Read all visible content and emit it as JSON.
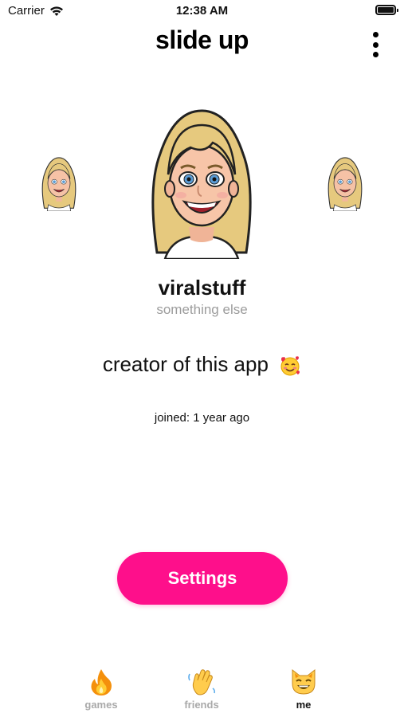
{
  "status_bar": {
    "carrier": "Carrier",
    "time": "12:38 AM"
  },
  "header": {
    "title": "slide up"
  },
  "profile": {
    "username": "viralstuff",
    "subtitle": "something else",
    "bio": "creator of this app",
    "bio_emoji": "smiling-face-with-hearts",
    "joined": "joined: 1 year ago"
  },
  "actions": {
    "settings_label": "Settings"
  },
  "tabs": [
    {
      "label": "games",
      "icon": "fire-icon",
      "active": false
    },
    {
      "label": "friends",
      "icon": "waving-hand-icon",
      "active": false
    },
    {
      "label": "me",
      "icon": "cat-face-icon",
      "active": true
    }
  ],
  "colors": {
    "accent": "#fe0f8b",
    "muted_text": "#9c9c9c",
    "tab_inactive": "#a9a9a9"
  }
}
